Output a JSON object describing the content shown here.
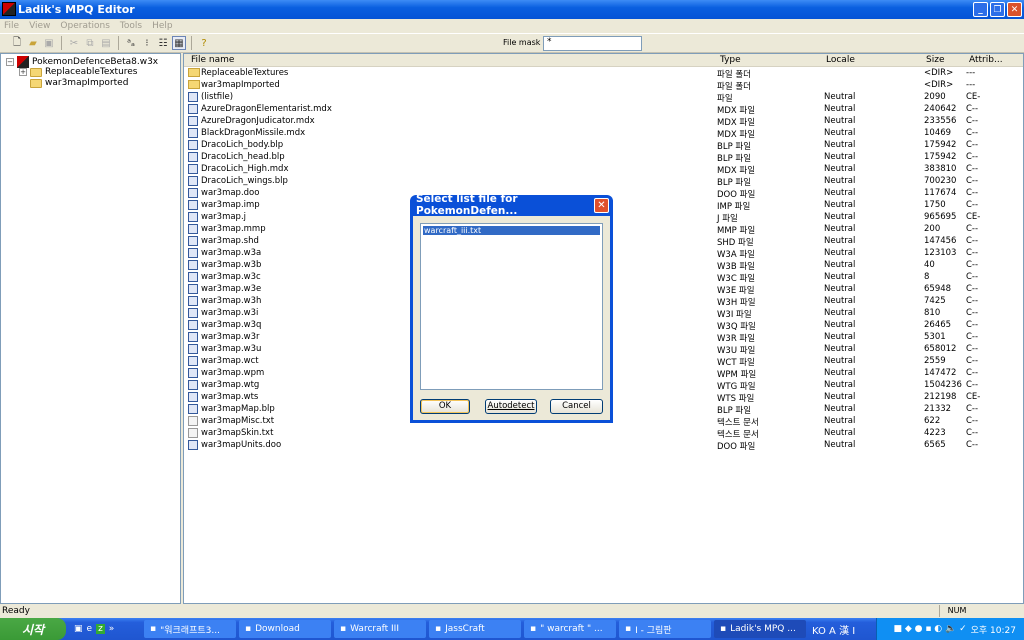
{
  "window": {
    "title": "Ladik's MPQ Editor",
    "minimize": "_",
    "maximize": "❐",
    "close": "✕"
  },
  "menu": [
    "File",
    "View",
    "Operations",
    "Tools",
    "Help"
  ],
  "toolbar": {
    "file_mask_label": "File mask :",
    "file_mask_value": "*"
  },
  "tree": {
    "root": "PokemonDefenceBeta8.w3x",
    "children": [
      "ReplaceableTextures",
      "war3mapImported"
    ]
  },
  "list": {
    "columns": [
      "File name",
      "Type",
      "Locale",
      "Size",
      "Attrib..."
    ],
    "rows": [
      [
        "ReplaceableTextures",
        "파일 폴더",
        "",
        "<DIR>",
        "---",
        "dir"
      ],
      [
        "war3mapImported",
        "파일 폴더",
        "",
        "<DIR>",
        "---",
        "dir"
      ],
      [
        "(listfile)",
        "파일",
        "Neutral",
        "2090",
        "CE-",
        "file"
      ],
      [
        "AzureDragonElementarist.mdx",
        "MDX 파일",
        "Neutral",
        "240642",
        "C--",
        "file"
      ],
      [
        "AzureDragonJudicator.mdx",
        "MDX 파일",
        "Neutral",
        "233556",
        "C--",
        "file"
      ],
      [
        "BlackDragonMissile.mdx",
        "MDX 파일",
        "Neutral",
        "10469",
        "C--",
        "file"
      ],
      [
        "DracoLich_body.blp",
        "BLP 파일",
        "Neutral",
        "175942",
        "C--",
        "file"
      ],
      [
        "DracoLich_head.blp",
        "BLP 파일",
        "Neutral",
        "175942",
        "C--",
        "file"
      ],
      [
        "DracoLich_High.mdx",
        "MDX 파일",
        "Neutral",
        "383810",
        "C--",
        "file"
      ],
      [
        "DracoLich_wings.blp",
        "BLP 파일",
        "Neutral",
        "700230",
        "C--",
        "file"
      ],
      [
        "war3map.doo",
        "DOO 파일",
        "Neutral",
        "117674",
        "C--",
        "file"
      ],
      [
        "war3map.imp",
        "IMP 파일",
        "Neutral",
        "1750",
        "C--",
        "file"
      ],
      [
        "war3map.j",
        "J 파일",
        "Neutral",
        "965695",
        "CE-",
        "file"
      ],
      [
        "war3map.mmp",
        "MMP 파일",
        "Neutral",
        "200",
        "C--",
        "file"
      ],
      [
        "war3map.shd",
        "SHD 파일",
        "Neutral",
        "147456",
        "C--",
        "file"
      ],
      [
        "war3map.w3a",
        "W3A 파일",
        "Neutral",
        "123103",
        "C--",
        "file"
      ],
      [
        "war3map.w3b",
        "W3B 파일",
        "Neutral",
        "40",
        "C--",
        "file"
      ],
      [
        "war3map.w3c",
        "W3C 파일",
        "Neutral",
        "8",
        "C--",
        "file"
      ],
      [
        "war3map.w3e",
        "W3E 파일",
        "Neutral",
        "65948",
        "C--",
        "file"
      ],
      [
        "war3map.w3h",
        "W3H 파일",
        "Neutral",
        "7425",
        "C--",
        "file"
      ],
      [
        "war3map.w3i",
        "W3I 파일",
        "Neutral",
        "810",
        "C--",
        "file"
      ],
      [
        "war3map.w3q",
        "W3Q 파일",
        "Neutral",
        "26465",
        "C--",
        "file"
      ],
      [
        "war3map.w3r",
        "W3R 파일",
        "Neutral",
        "5301",
        "C--",
        "file"
      ],
      [
        "war3map.w3u",
        "W3U 파일",
        "Neutral",
        "658012",
        "C--",
        "file"
      ],
      [
        "war3map.wct",
        "WCT 파일",
        "Neutral",
        "2559",
        "C--",
        "file"
      ],
      [
        "war3map.wpm",
        "WPM 파일",
        "Neutral",
        "147472",
        "C--",
        "file"
      ],
      [
        "war3map.wtg",
        "WTG 파일",
        "Neutral",
        "1504236",
        "C--",
        "file"
      ],
      [
        "war3map.wts",
        "WTS 파일",
        "Neutral",
        "212198",
        "CE-",
        "file"
      ],
      [
        "war3mapMap.blp",
        "BLP 파일",
        "Neutral",
        "21332",
        "C--",
        "file"
      ],
      [
        "war3mapMisc.txt",
        "텍스트 문서",
        "Neutral",
        "622",
        "C--",
        "txt"
      ],
      [
        "war3mapSkin.txt",
        "텍스트 문서",
        "Neutral",
        "4223",
        "C--",
        "txt"
      ],
      [
        "war3mapUnits.doo",
        "DOO 파일",
        "Neutral",
        "6565",
        "C--",
        "file"
      ]
    ]
  },
  "dialog": {
    "title": "Select list file for PokemonDefen...",
    "close": "✕",
    "items": [
      "warcraft_iii.txt"
    ],
    "ok": "OK",
    "autodetect": "Autodetect",
    "cancel": "Cancel"
  },
  "status": {
    "text": "Ready",
    "num": "NUM"
  },
  "taskbar": {
    "start": "시작",
    "quicklaunch_more": "»",
    "tasks": [
      "\"워크래프트3...",
      "Download",
      "Warcraft III",
      "JassCraft",
      "\" warcraft \" ...",
      "I - 그림판",
      "Ladik's MPQ ..."
    ],
    "active_task": 6,
    "ime": "KO A 漢 I",
    "clock": "오후 10:27"
  }
}
